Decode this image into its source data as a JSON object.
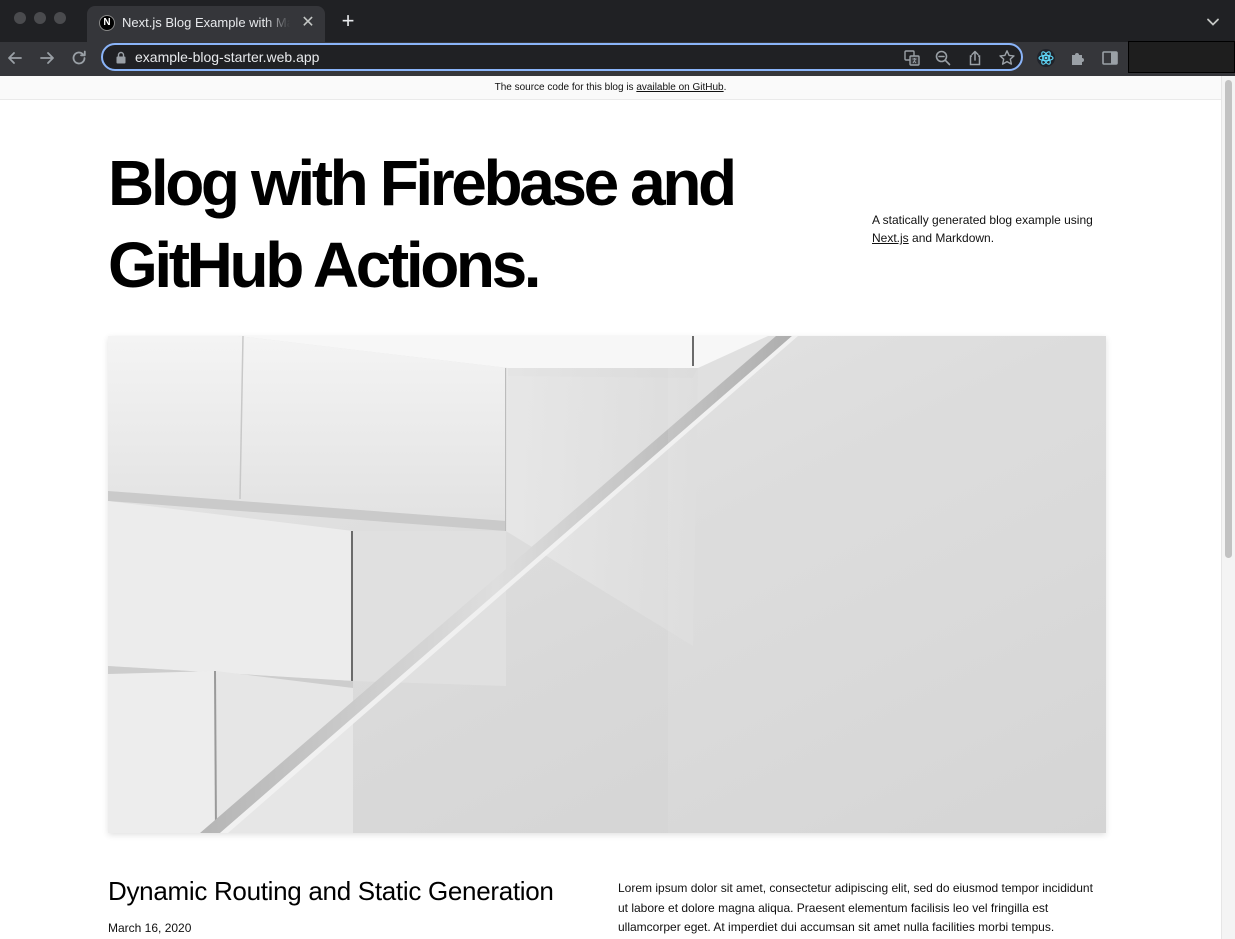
{
  "browser": {
    "tab_title": "Next.js Blog Example with Markdown",
    "tab_favicon_letter": "N",
    "tab_close_glyph": "✕",
    "new_tab_glyph": "+",
    "url": "example-blog-starter.web.app",
    "accent": "#8ab4f8"
  },
  "page": {
    "alert": {
      "prefix": "The source code for this blog is ",
      "link_text": "available on GitHub",
      "suffix": "."
    },
    "hero": {
      "title": "Blog with Firebase and GitHub Actions.",
      "intro_prefix": "A statically generated blog example using ",
      "intro_link": "Next.js",
      "intro_suffix": " and Markdown."
    },
    "post": {
      "title": "Dynamic Routing and Static Generation",
      "date": "March 16, 2020",
      "excerpt": "Lorem ipsum dolor sit amet, consectetur adipiscing elit, sed do eiusmod tempor incididunt ut labore et dolore magna aliqua. Praesent elementum facilisis leo vel fringilla est ullamcorper eget. At imperdiet dui accumsan sit amet nulla facilities morbi tempus."
    }
  }
}
